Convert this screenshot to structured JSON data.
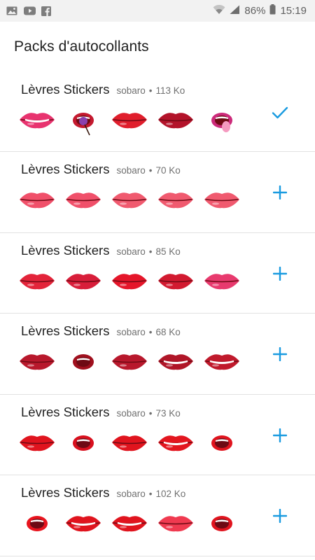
{
  "status_bar": {
    "battery": "86%",
    "time": "15:19",
    "icons": [
      "image-icon",
      "youtube-icon",
      "facebook-icon",
      "wifi-icon",
      "signal-icon",
      "battery-icon"
    ]
  },
  "header": {
    "title": "Packs d'autocollants"
  },
  "colors": {
    "accent": "#1a9be0",
    "divider": "#e2e2e2"
  },
  "packs": [
    {
      "name": "Lèvres Stickers",
      "author": "sobaro",
      "separator": "•",
      "size": "113 Ko",
      "action": "check-icon",
      "stickers": [
        "smile-pink-lips",
        "lollipop-lips",
        "red-kiss-lips",
        "dark-red-lips",
        "tongue-out-lips"
      ]
    },
    {
      "name": "Lèvres Stickers",
      "author": "sobaro",
      "separator": "•",
      "size": "70 Ko",
      "action": "plus-icon",
      "stickers": [
        "pink-lips-1",
        "pink-lips-2",
        "pink-lips-3",
        "pink-pout-lips",
        "pink-lips-4"
      ]
    },
    {
      "name": "Lèvres Stickers",
      "author": "sobaro",
      "separator": "•",
      "size": "85 Ko",
      "action": "plus-icon",
      "stickers": [
        "red-lips-1",
        "red-lips-2",
        "red-lips-3",
        "lip-bite",
        "pink-lips-5"
      ]
    },
    {
      "name": "Lèvres Stickers",
      "author": "sobaro",
      "separator": "•",
      "size": "68 Ko",
      "action": "plus-icon",
      "stickers": [
        "closed-lips",
        "open-mouth-lips",
        "closed-lips-2",
        "smile-lips",
        "smile-lips-2"
      ]
    },
    {
      "name": "Lèvres Stickers",
      "author": "sobaro",
      "separator": "•",
      "size": "73 Ko",
      "action": "plus-icon",
      "stickers": [
        "red-lips-tilt",
        "open-lips-tilt",
        "kiss-lips",
        "smile-lips-3",
        "open-lips-round"
      ]
    },
    {
      "name": "Lèvres Stickers",
      "author": "sobaro",
      "separator": "•",
      "size": "102 Ko",
      "action": "plus-icon",
      "stickers": [
        "shout-lips",
        "grin-lips",
        "teeth-smile-lips",
        "kiss-lips-2",
        "clench-teeth-lips"
      ]
    }
  ]
}
